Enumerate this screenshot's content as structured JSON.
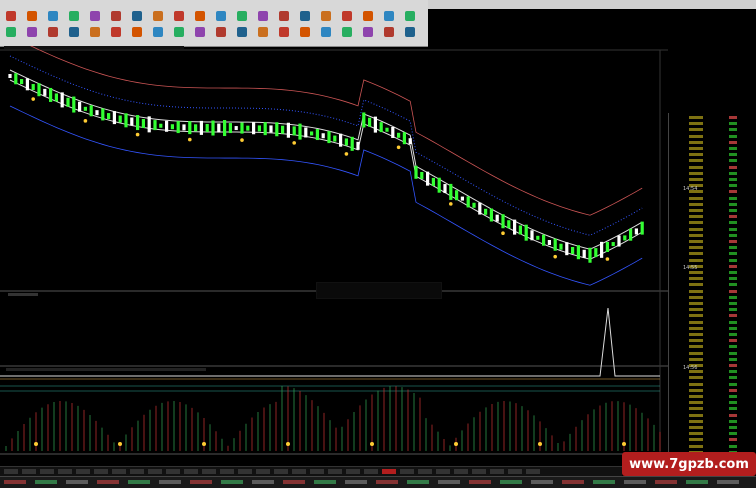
{
  "watermark": {
    "text": "www.7gpzb.com"
  },
  "colors": {
    "background": "#000000",
    "toolbar": "#d8d8d8",
    "candle_up": "#ffffff",
    "candle_down": "#33ff33",
    "ma_white": "#dddddd",
    "ma_blue": "#3355ff",
    "ma_red": "#cc5555",
    "accent_red": "#b21e1e",
    "dot_yellow": "#ffcc33",
    "quote_yellow": "#e6d020",
    "quote_green": "#33dd33",
    "quote_red": "#ff5555"
  },
  "icons": [
    "toolbar-button-icon",
    "chart-settings-icon"
  ],
  "quote_panel": {
    "times": [
      "14:54",
      "14:55",
      "14:56"
    ]
  }
}
